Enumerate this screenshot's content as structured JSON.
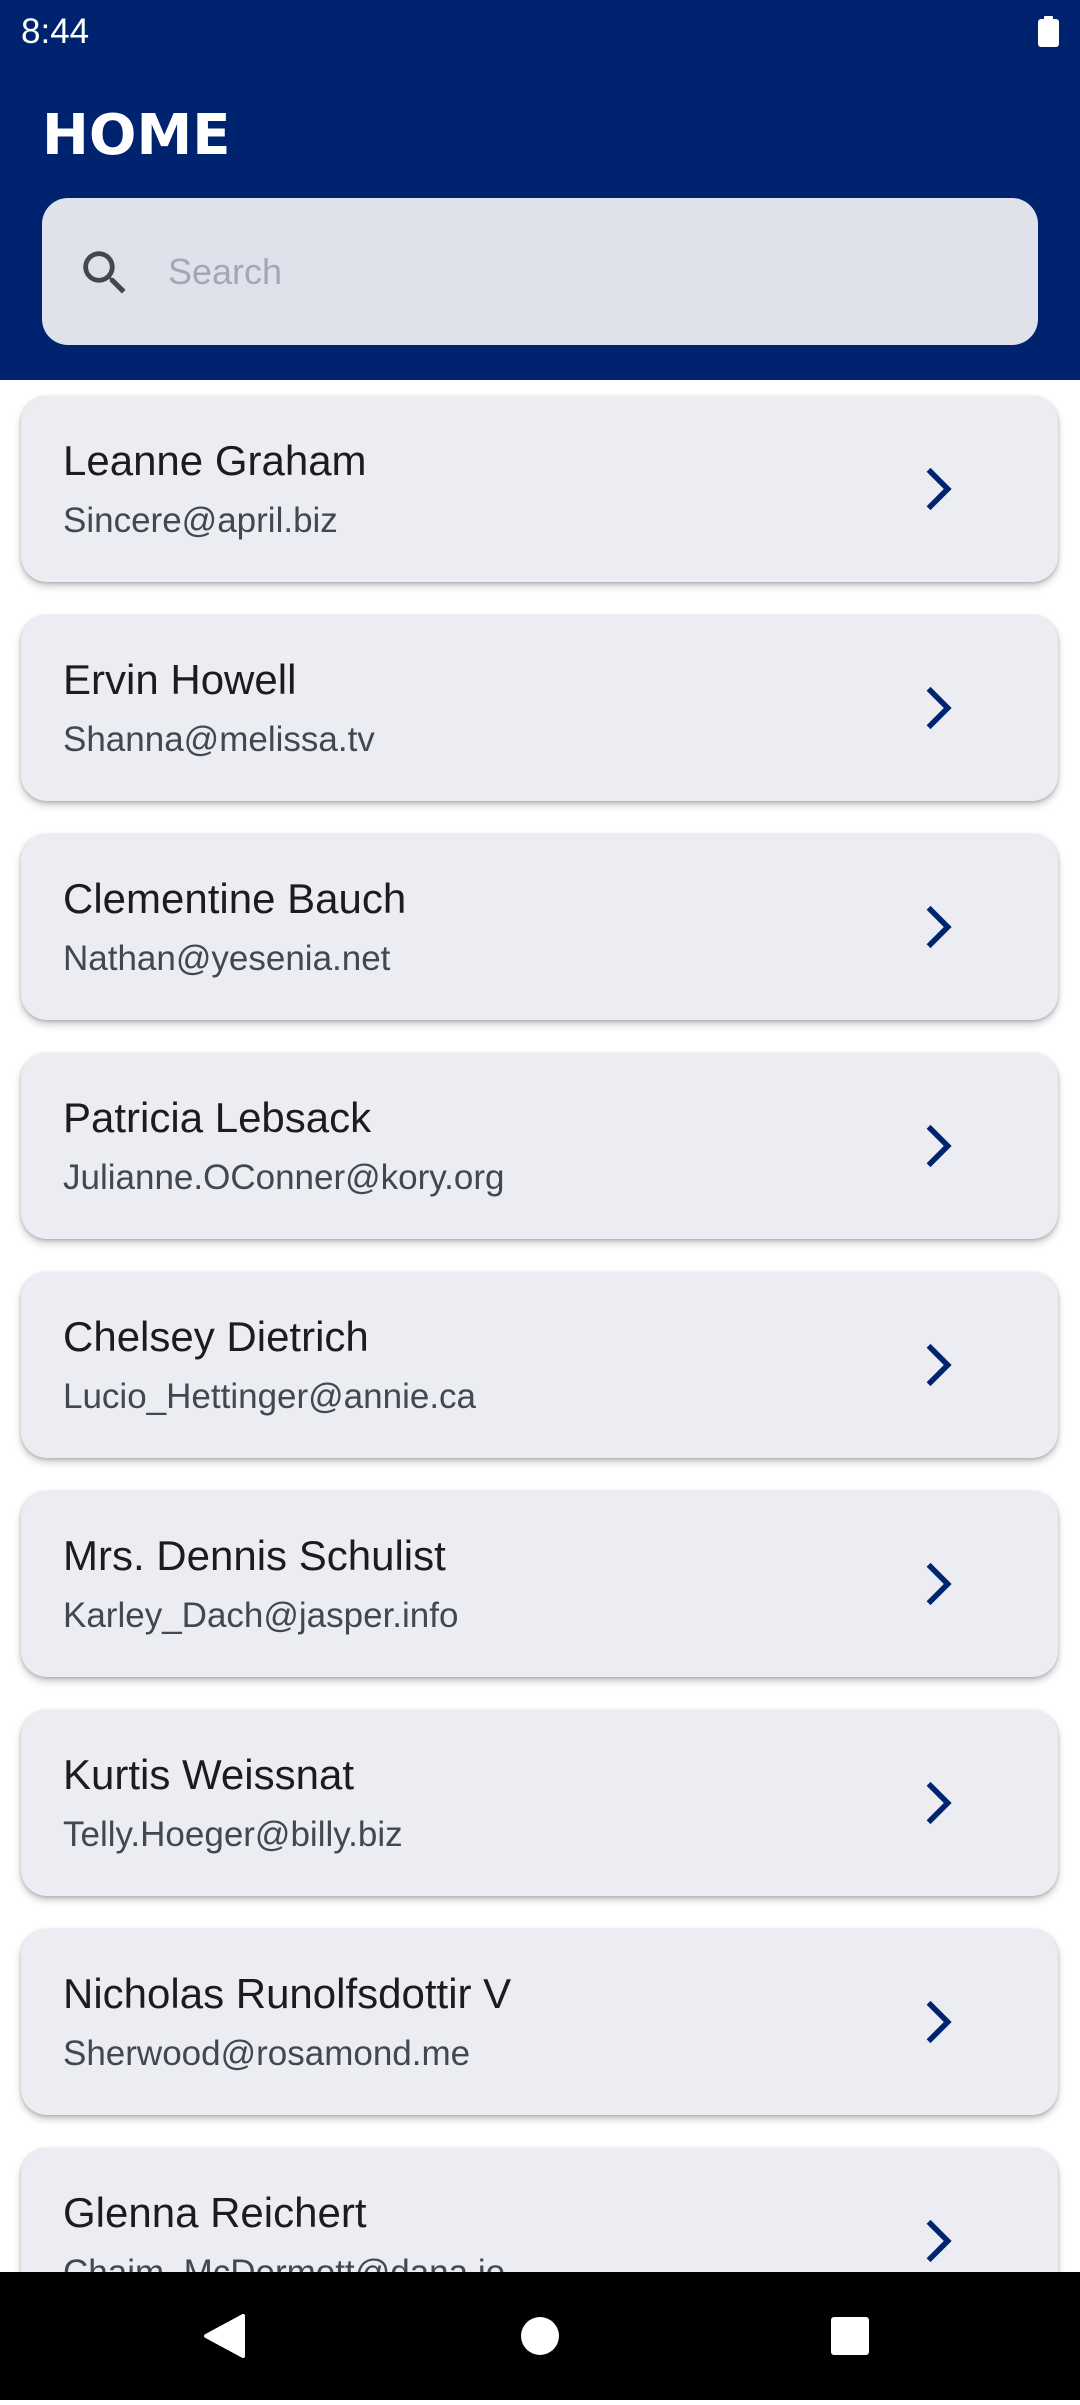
{
  "status_bar": {
    "time": "8:44",
    "battery_icon": "battery-full-icon"
  },
  "header": {
    "title": "HOME",
    "background_color": "#00236f"
  },
  "search": {
    "placeholder": "Search",
    "value": "",
    "icon": "search-icon"
  },
  "users": [
    {
      "name": "Leanne Graham",
      "email": "Sincere@april.biz"
    },
    {
      "name": "Ervin Howell",
      "email": "Shanna@melissa.tv"
    },
    {
      "name": "Clementine Bauch",
      "email": "Nathan@yesenia.net"
    },
    {
      "name": "Patricia Lebsack",
      "email": "Julianne.OConner@kory.org"
    },
    {
      "name": "Chelsey Dietrich",
      "email": "Lucio_Hettinger@annie.ca"
    },
    {
      "name": "Mrs. Dennis Schulist",
      "email": "Karley_Dach@jasper.info"
    },
    {
      "name": "Kurtis Weissnat",
      "email": "Telly.Hoeger@billy.biz"
    },
    {
      "name": "Nicholas Runolfsdottir V",
      "email": "Sherwood@rosamond.me"
    },
    {
      "name": "Glenna Reichert",
      "email": "Chaim_McDermott@dana.io"
    }
  ],
  "nav_bar": {
    "buttons": [
      "back-icon",
      "home-icon",
      "recents-icon"
    ]
  },
  "colors": {
    "accent": "#00236f",
    "card_background": "#ecedf3",
    "search_background": "#dfe2eb"
  }
}
